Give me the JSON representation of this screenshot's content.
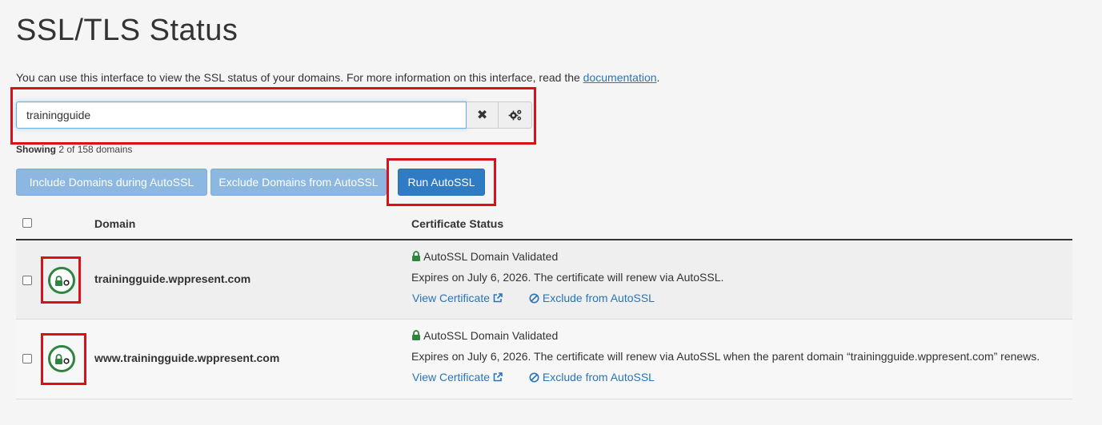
{
  "page": {
    "title": "SSL/TLS Status",
    "intro_text": "You can use this interface to view the SSL status of your domains. For more information on this interface, read the ",
    "intro_link": "documentation",
    "intro_end": "."
  },
  "search": {
    "value": "trainingguide",
    "clear_icon": "close-icon",
    "settings_icon": "gears-icon"
  },
  "showing": {
    "label": "Showing",
    "text": "2 of 158 domains"
  },
  "buttons": {
    "include": "Include Domains during AutoSSL",
    "exclude": "Exclude Domains from AutoSSL",
    "run": "Run AutoSSL"
  },
  "table": {
    "headers": {
      "domain": "Domain",
      "status": "Certificate Status"
    },
    "rows": [
      {
        "domain": "trainingguide.wppresent.com",
        "status_title": "AutoSSL Domain Validated",
        "expires": "Expires on July 6, 2026. The certificate will renew via AutoSSL.",
        "view_link": "View Certificate",
        "exclude_link": "Exclude from AutoSSL"
      },
      {
        "domain": "www.trainingguide.wppresent.com",
        "status_title": "AutoSSL Domain Validated",
        "expires": "Expires on July 6, 2026. The certificate will renew via AutoSSL when the parent domain “trainingguide.wppresent.com” renews.",
        "view_link": "View Certificate",
        "exclude_link": "Exclude from AutoSSL"
      }
    ]
  },
  "colors": {
    "accent": "#2f7bc4",
    "valid": "#2e8540",
    "highlight": "#d9121a"
  }
}
